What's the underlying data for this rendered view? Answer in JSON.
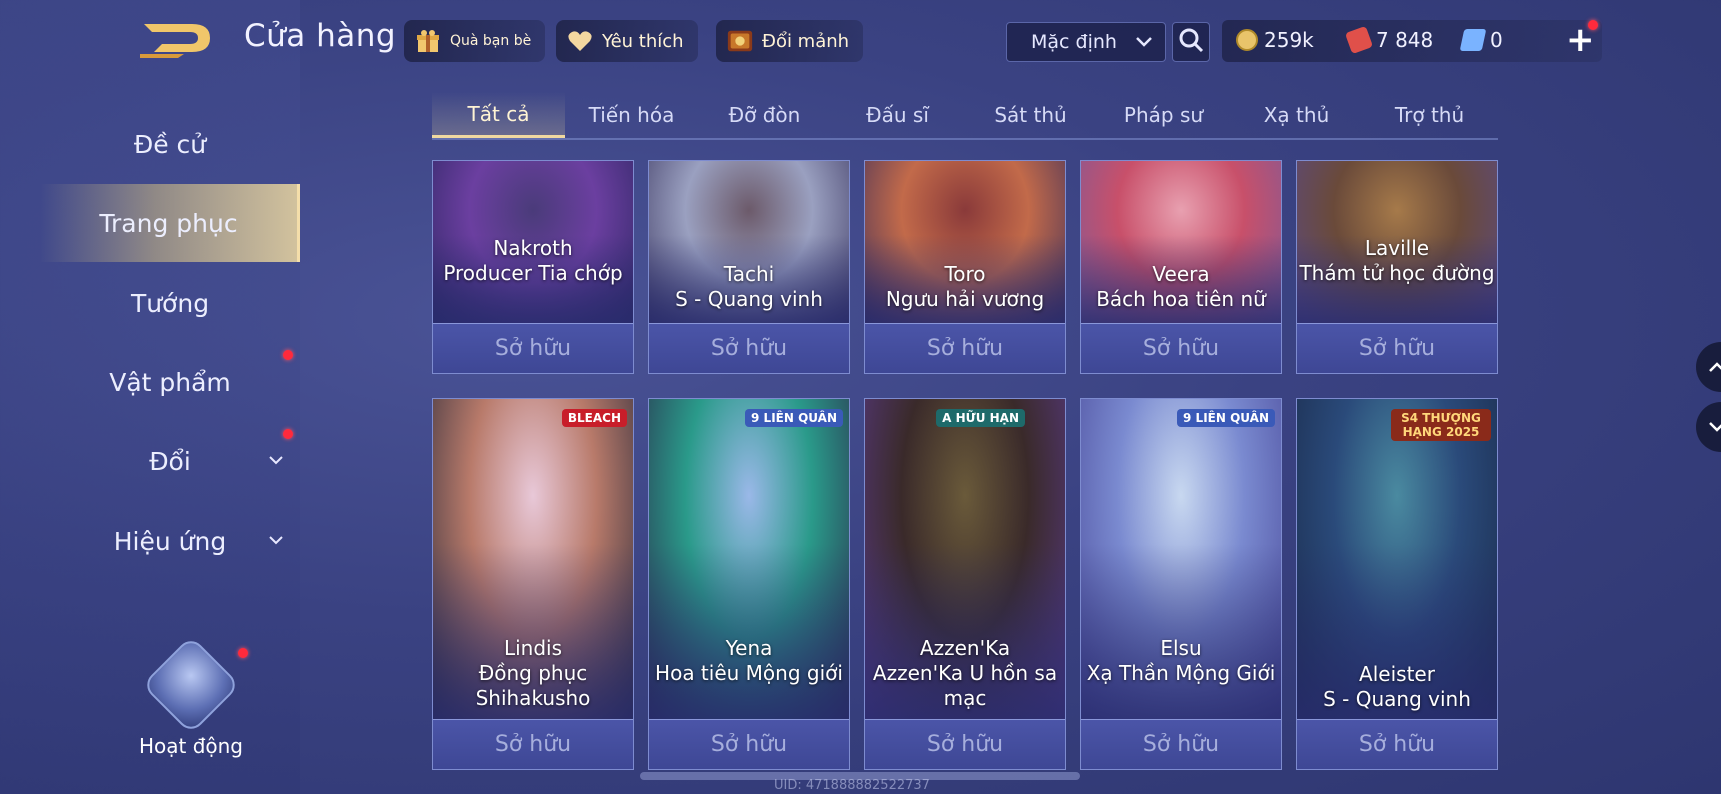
{
  "header": {
    "title": "Cửa hàng",
    "chips": [
      {
        "label": "Quà bạn bè",
        "icon": "gift-icon"
      },
      {
        "label": "Yêu thích",
        "icon": "heart-icon"
      },
      {
        "label": "Đổi mảnh",
        "icon": "shard-chest-icon"
      }
    ],
    "sort": {
      "value": "Mặc định"
    },
    "currencies": [
      {
        "value": "259k",
        "icon": "gold-coin-icon",
        "color": "#e9c46a"
      },
      {
        "value": "7 848",
        "icon": "red-voucher-icon",
        "color": "#e0504a"
      },
      {
        "value": "0",
        "icon": "blue-crystal-icon",
        "color": "#7ab3ff"
      }
    ],
    "plus": "+"
  },
  "sidebar": {
    "items": [
      {
        "label": "Đề cử",
        "active": false,
        "dot": false,
        "caret": false
      },
      {
        "label": "Trang phục",
        "active": true,
        "dot": false,
        "caret": false
      },
      {
        "label": "Tướng",
        "active": false,
        "dot": false,
        "caret": false
      },
      {
        "label": "Vật phẩm",
        "active": false,
        "dot": true,
        "caret": false
      },
      {
        "label": "Đổi",
        "active": false,
        "dot": true,
        "caret": true
      },
      {
        "label": "Hiệu ứng",
        "active": false,
        "dot": false,
        "caret": true
      }
    ],
    "activity": {
      "label": "Hoạt động"
    }
  },
  "tabs": [
    "Tất cả",
    "Tiến hóa",
    "Đỡ đòn",
    "Đấu sĩ",
    "Sát thủ",
    "Pháp sư",
    "Xạ thủ",
    "Trợ thủ"
  ],
  "active_tab": 0,
  "cards": [
    {
      "hero": "Nakroth",
      "skin": "Producer Tia chớp",
      "status": "Sở hữu",
      "palette": [
        "#4a3b7a",
        "#6b3fa0",
        "#2a2560"
      ],
      "badge": ""
    },
    {
      "hero": "Tachi",
      "skin": "S - Quang vinh",
      "status": "Sở hữu",
      "palette": [
        "#6c5a6a",
        "#9aa0c0",
        "#3a3560"
      ],
      "badge": ""
    },
    {
      "hero": "Toro",
      "skin": "Ngưu hải vương",
      "status": "Sở hữu",
      "palette": [
        "#8a3a3a",
        "#c26a4a",
        "#3b2d5a"
      ],
      "badge": ""
    },
    {
      "hero": "Veera",
      "skin": "Bách hoa tiên nữ",
      "status": "Sở hữu",
      "palette": [
        "#e8a0b0",
        "#c8506a",
        "#7a5a9a"
      ],
      "badge": ""
    },
    {
      "hero": "Laville",
      "skin": "Thám tử học đường",
      "status": "Sở hữu",
      "palette": [
        "#a67a4a",
        "#6a4a3a",
        "#5a4a8a"
      ],
      "badge": ""
    },
    {
      "hero": "Lindis",
      "skin": "Đồng phục Shihakusho",
      "status": "Sở hữu",
      "palette": [
        "#e8c8d8",
        "#b87a6a",
        "#2a2a3a"
      ],
      "badge": "BLEACH"
    },
    {
      "hero": "Yena",
      "skin": "Hoa tiêu Mộng giới",
      "status": "Sở hữu",
      "palette": [
        "#9ab8e8",
        "#2a9a8a",
        "#2a2a4a"
      ],
      "badge": "9 LIÊN QUÂN"
    },
    {
      "hero": "Azzen'Ka",
      "skin": "Azzen'Ka U hồn sa mạc",
      "status": "Sở hữu",
      "palette": [
        "#6a5a3a",
        "#3a2a2a",
        "#5a3a8a"
      ],
      "badge": "A HỮU HẠN"
    },
    {
      "hero": "Elsu",
      "skin": "Xạ Thần Mộng Giới",
      "status": "Sở hữu",
      "palette": [
        "#c8d8f0",
        "#7a8ad0",
        "#4a4a9a"
      ],
      "badge": "9 LIÊN QUÂN"
    },
    {
      "hero": "Aleister",
      "skin": "S - Quang vinh",
      "status": "Sở hữu",
      "palette": [
        "#4a8aa0",
        "#2a4a7a",
        "#1a2a4a"
      ],
      "badge": "S4 THƯỢNG HẠNG 2025"
    }
  ],
  "uid": "UID: 471888882522737"
}
